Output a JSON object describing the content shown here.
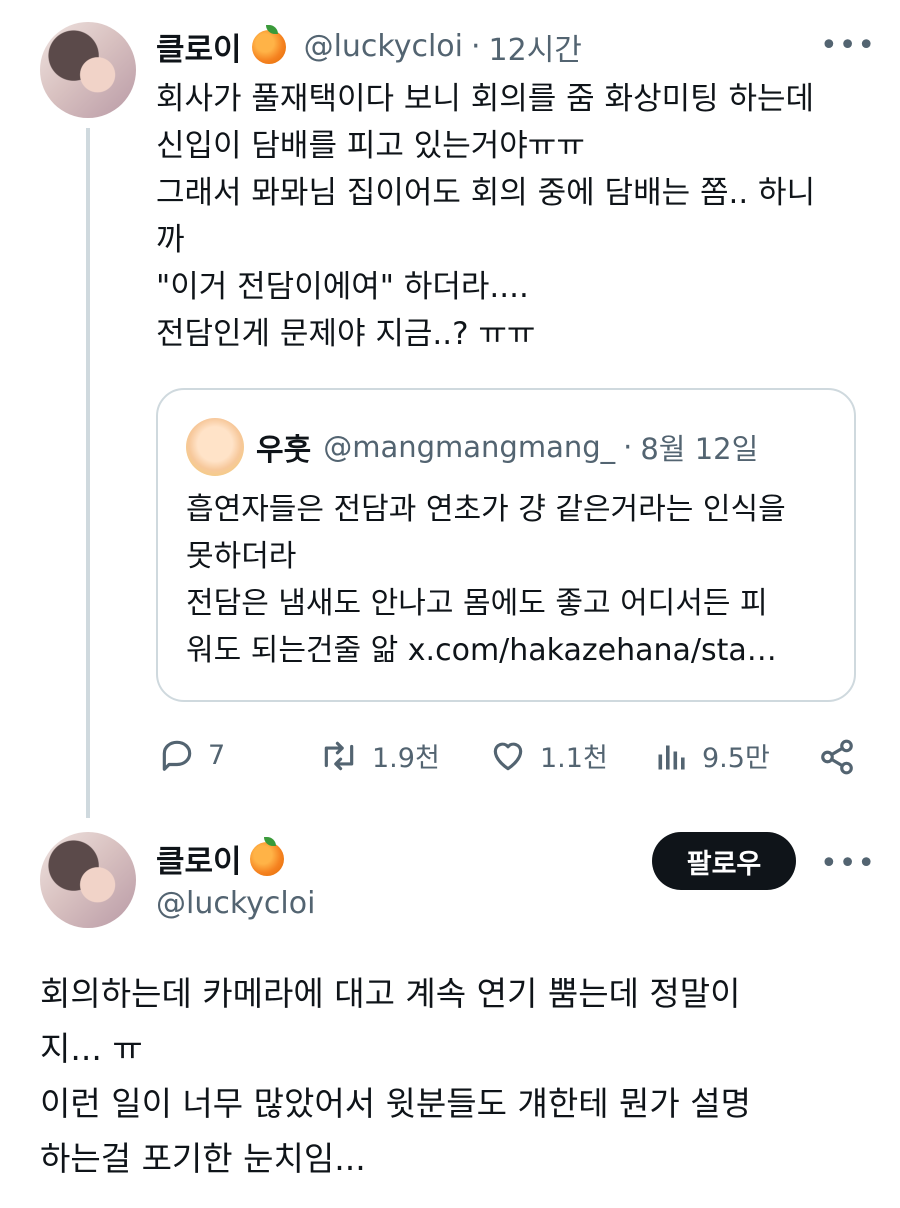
{
  "reply_post": {
    "author": "클로이",
    "handle": "@luckycloi",
    "separator": "·",
    "time": "12시간",
    "lines": [
      "회사가 풀재택이다 보니 회의를 줌 화상미팅 하는데",
      "신입이 담배를 피고 있는거야ㅠㅠ",
      "그래서 뫄뫄님 집이어도 회의 중에 담배는 쫌.. 하니",
      "까",
      "\"이거 전담이에여\" 하더라....",
      "전담인게 문제야 지금..? ㅠㅠ"
    ],
    "quote": {
      "author": "우훗",
      "handle": "@mangmangmang_",
      "separator": "·",
      "date": "8월 12일",
      "lines": [
        "흡연자들은 전담과 연초가 걍 같은거라는 인식을",
        "못하더라",
        "전담은 냄새도 안나고 몸에도 좋고 어디서든 피",
        "워도 되는건줄 앎 x.com/hakazehana/sta…"
      ]
    },
    "actions": {
      "replies": "7",
      "reposts": "1.9천",
      "likes": "1.1천",
      "views": "9.5만"
    }
  },
  "main_post": {
    "author": "클로이",
    "handle": "@luckycloi",
    "follow_label": "팔로우",
    "lines": [
      "회의하는데 카메라에 대고 계속 연기 뿜는데 정말이",
      "지... ㅠ",
      "이런 일이 너무 많았어서 윗분들도 걔한테 뭔가 설명",
      "하는걸 포기한 눈치임..."
    ]
  },
  "colors": {
    "text": "#0f1419",
    "secondary": "#536471",
    "border": "#cfd9de",
    "button_bg": "#0f1419"
  },
  "icons": [
    "orange-emoji-icon",
    "more-icon",
    "reply-icon",
    "repost-icon",
    "like-icon",
    "views-icon",
    "share-icon"
  ]
}
